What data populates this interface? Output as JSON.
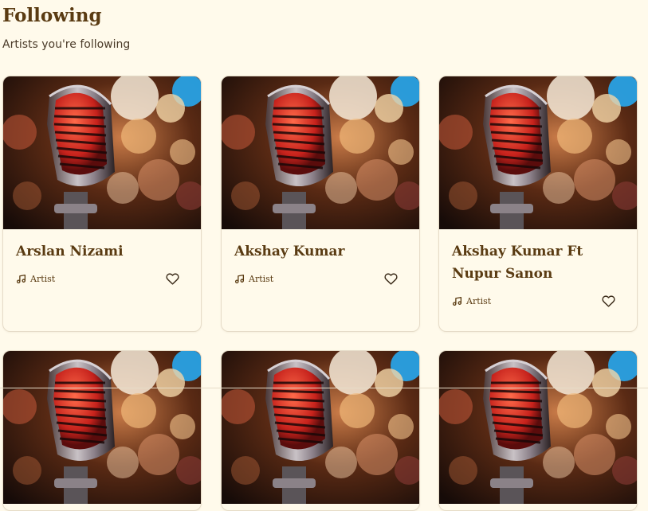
{
  "header": {
    "title": "Following",
    "subtitle": "Artists you're following"
  },
  "cards": [
    {
      "name": "Arslan Nizami",
      "type_label": "Artist",
      "type_icon": "music-note-icon",
      "like_icon": "heart-outline-icon",
      "lines": 1
    },
    {
      "name": "Akshay Kumar",
      "type_label": "Artist",
      "type_icon": "music-note-icon",
      "like_icon": "heart-outline-icon",
      "lines": 1
    },
    {
      "name": "Akshay Kumar Ft Nupur Sanon",
      "type_label": "Artist",
      "type_icon": "music-note-icon",
      "like_icon": "heart-outline-icon",
      "lines": 2
    }
  ],
  "colors": {
    "background": "#fffaeb",
    "text": "#5a3b12",
    "border": "#e6dcc8"
  }
}
